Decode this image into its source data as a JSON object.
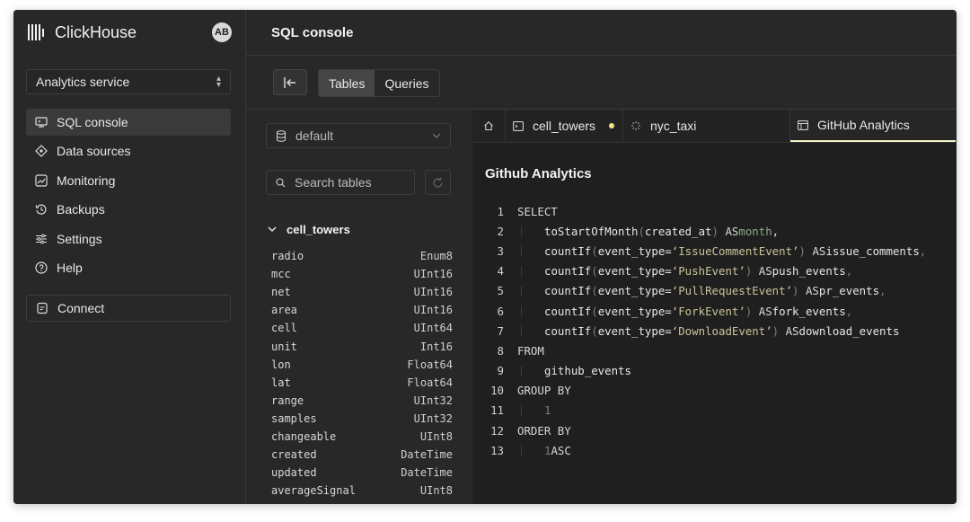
{
  "app": {
    "brand": "ClickHouse",
    "avatar_initials": "AB"
  },
  "sidebar": {
    "service": "Analytics service",
    "items": [
      {
        "label": "SQL console",
        "icon": "console-icon",
        "active": true
      },
      {
        "label": "Data sources",
        "icon": "data-sources-icon"
      },
      {
        "label": "Monitoring",
        "icon": "monitoring-icon"
      },
      {
        "label": "Backups",
        "icon": "backups-icon"
      },
      {
        "label": "Settings",
        "icon": "settings-icon"
      },
      {
        "label": "Help",
        "icon": "help-icon"
      }
    ],
    "connect": "Connect"
  },
  "header": {
    "title": "SQL console"
  },
  "toolbar": {
    "tables_label": "Tables",
    "queries_label": "Queries",
    "active": "Tables"
  },
  "tables_pane": {
    "database": "default",
    "search_placeholder": "Search tables",
    "table_name": "cell_towers",
    "columns": [
      {
        "name": "radio",
        "type": "Enum8"
      },
      {
        "name": "mcc",
        "type": "UInt16"
      },
      {
        "name": "net",
        "type": "UInt16"
      },
      {
        "name": "area",
        "type": "UInt16"
      },
      {
        "name": "cell",
        "type": "UInt64"
      },
      {
        "name": "unit",
        "type": "Int16"
      },
      {
        "name": "lon",
        "type": "Float64"
      },
      {
        "name": "lat",
        "type": "Float64"
      },
      {
        "name": "range",
        "type": "UInt32"
      },
      {
        "name": "samples",
        "type": "UInt32"
      },
      {
        "name": "changeable",
        "type": "UInt8"
      },
      {
        "name": "created",
        "type": "DateTime"
      },
      {
        "name": "updated",
        "type": "DateTime"
      },
      {
        "name": "averageSignal",
        "type": "UInt8"
      }
    ]
  },
  "editor": {
    "tabs": [
      {
        "label": "cell_towers",
        "icon": "terminal-icon",
        "unsaved": true
      },
      {
        "label": "nyc_taxi",
        "icon": "loading-icon"
      },
      {
        "label": "GitHub Analytics",
        "icon": "table-icon",
        "active": true
      }
    ],
    "query_title": "Github Analytics",
    "line_numbers": [
      "1",
      "2",
      "3",
      "4",
      "5",
      "6",
      "7",
      "8",
      "9",
      "10",
      "11",
      "12",
      "13"
    ],
    "code": {
      "l1": "SELECT",
      "l2_fn": "toStartOfMonth",
      "l2_arg": "created_at",
      "l2_as": "AS",
      "l2_alias": "month",
      "fn_count": "countIf",
      "arg_event": "event_type",
      "eq": "=",
      "as_kw": "AS",
      "l3_str": "‘IssueCommentEvent’",
      "l3_alias": "issue_comments",
      "l4_str": "‘PushEvent’",
      "l4_alias": "push_events",
      "l5_str": "‘PullRequestEvent’",
      "l5_alias": "pr_events",
      "l6_str": "‘ForkEvent’",
      "l6_alias": "fork_events",
      "l7_str": "‘DownloadEvent’",
      "l7_alias": "download_events",
      "l8": "FROM",
      "l9": "github_events",
      "l10": "GROUP BY",
      "l11": "1",
      "l12": "ORDER BY",
      "l13_num": "1",
      "l13_kw": "ASC"
    }
  },
  "colors": {
    "accent_tab": "#f5f3c8",
    "unsaved_dot": "#f3e58a",
    "string": "#c9c39a",
    "alias_month": "#8fa98a"
  }
}
